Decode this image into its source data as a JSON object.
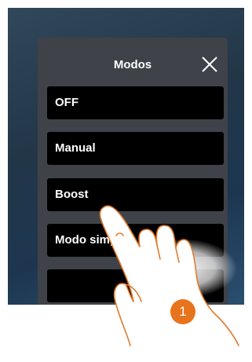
{
  "dialog": {
    "title": "Modos",
    "close_icon": "close-icon",
    "modes": [
      "OFF",
      "Manual",
      "Boost",
      "Modo simple",
      ""
    ]
  },
  "annotation": {
    "step_number": "1",
    "badge_color": "#e8731d",
    "hand_icon": "pointing-hand-icon"
  },
  "colors": {
    "panel": "#3f4248",
    "button": "#000000",
    "text": "#ffffff"
  }
}
